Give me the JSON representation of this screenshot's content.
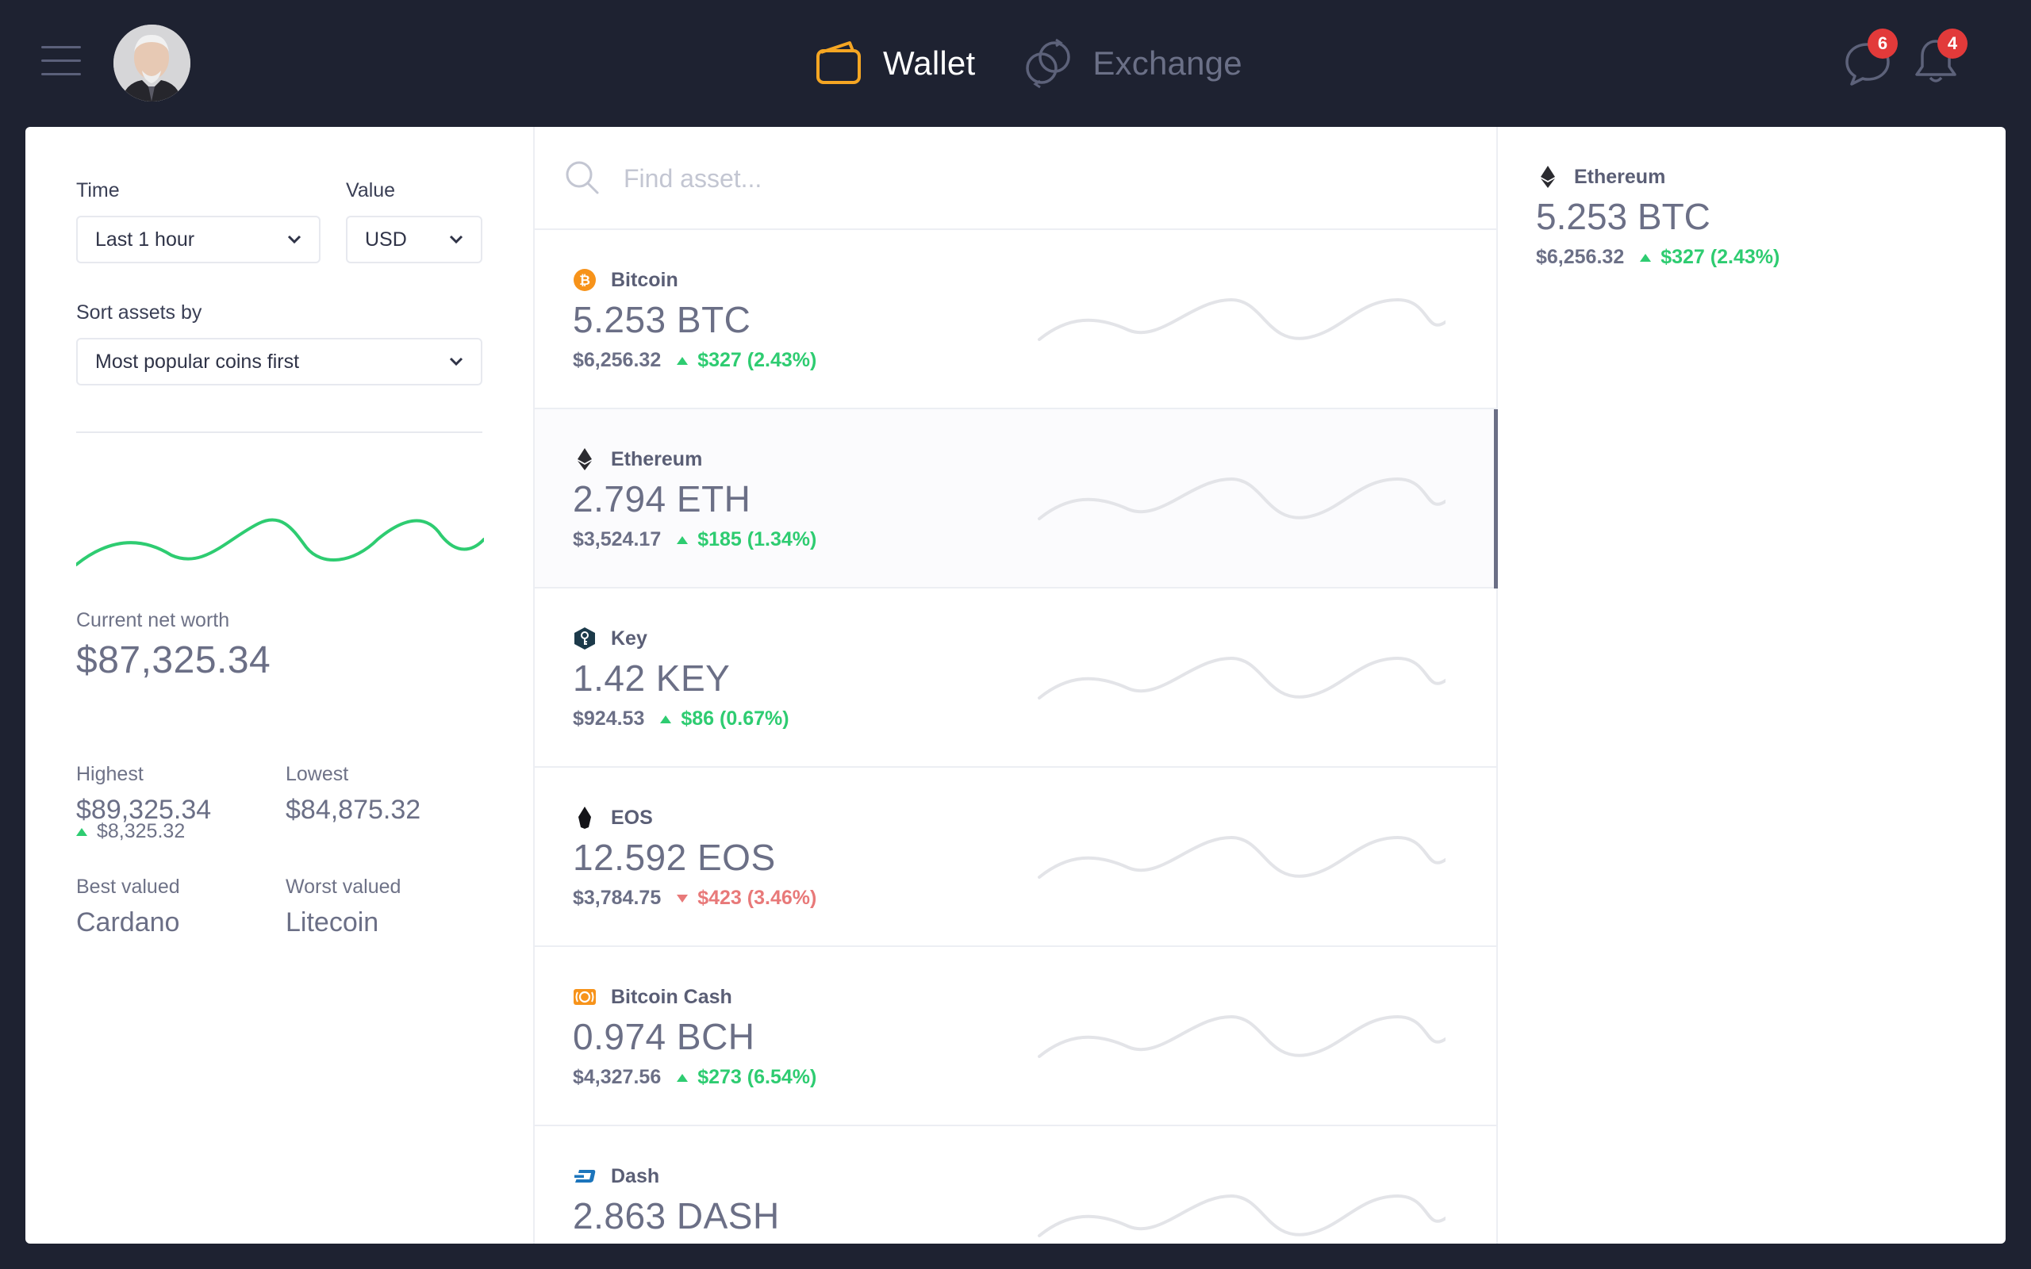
{
  "header": {
    "nav": [
      {
        "label": "Wallet",
        "active": true,
        "icon": "wallet-icon"
      },
      {
        "label": "Exchange",
        "active": false,
        "icon": "exchange-icon"
      }
    ],
    "messages_badge": "6",
    "notifications_badge": "4"
  },
  "filters": {
    "time_label": "Time",
    "time_value": "Last 1 hour",
    "value_label": "Value",
    "value_value": "USD",
    "sort_label": "Sort assets by",
    "sort_value": "Most popular coins first"
  },
  "summary": {
    "net_worth_label": "Current net worth",
    "net_worth": "$87,325.34",
    "net_worth_change": "$8,325.32",
    "highest_label": "Highest",
    "highest": "$89,325.34",
    "lowest_label": "Lowest",
    "lowest": "$84,875.32",
    "best_label": "Best valued",
    "best": "Cardano",
    "worst_label": "Worst valued",
    "worst": "Litecoin"
  },
  "search": {
    "placeholder": "Find asset..."
  },
  "assets": [
    {
      "name": "Bitcoin",
      "amount": "5.253 BTC",
      "usd": "$6,256.32",
      "change": "$327 (2.43%)",
      "direction": "up",
      "icon": "bitcoin-icon"
    },
    {
      "name": "Ethereum",
      "amount": "2.794 ETH",
      "usd": "$3,524.17",
      "change": "$185 (1.34%)",
      "direction": "up",
      "icon": "ethereum-icon"
    },
    {
      "name": "Key",
      "amount": "1.42 KEY",
      "usd": "$924.53",
      "change": "$86 (0.67%)",
      "direction": "up",
      "icon": "key-icon"
    },
    {
      "name": "EOS",
      "amount": "12.592 EOS",
      "usd": "$3,784.75",
      "change": "$423 (3.46%)",
      "direction": "down",
      "icon": "eos-icon"
    },
    {
      "name": "Bitcoin Cash",
      "amount": "0.974 BCH",
      "usd": "$4,327.56",
      "change": "$273 (6.54%)",
      "direction": "up",
      "icon": "bitcoin-cash-icon"
    },
    {
      "name": "Dash",
      "amount": "2.863 DASH",
      "usd": "",
      "change": "",
      "direction": "up",
      "icon": "dash-icon"
    }
  ],
  "detail": {
    "name": "Ethereum",
    "amount": "5.253 BTC",
    "usd": "$6,256.32",
    "change": "$327 (2.43%)"
  },
  "colors": {
    "background": "#1e2231",
    "up": "#2ecc71",
    "down": "#e87979",
    "wallet_accent": "#f5a623",
    "badge": "#e23a3a"
  }
}
